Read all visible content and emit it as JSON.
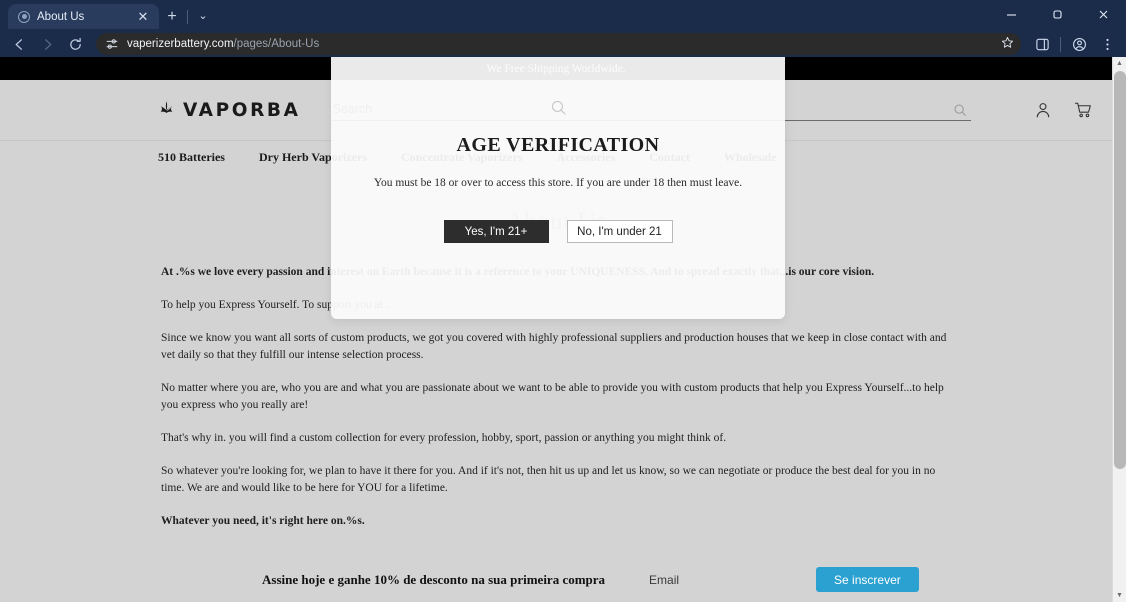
{
  "browser": {
    "tab": {
      "title": "About Us",
      "favicon": "globe-icon",
      "close": "✕"
    },
    "newtab_label": "+",
    "tablist_label": "⌄",
    "window": {
      "minimize": "—",
      "maximize": "⬜",
      "close": "✕"
    },
    "nav": {
      "back": "←",
      "forward": "→",
      "reload": "⟳"
    },
    "omnibox": {
      "domain": "vaperizerbattery.com",
      "path": "/pages/About-Us",
      "site_settings_icon": "tune-icon",
      "bookmark_icon": "star-icon"
    },
    "toolbar_icons": {
      "side_panel": "side-panel-icon",
      "profile": "profile-icon",
      "menu": "kebab-menu-icon"
    }
  },
  "site": {
    "announcement": "We Free Shipping Worldwide.",
    "logo": {
      "text": "VAPORBA",
      "icon": "cannabis-leaf-icon"
    },
    "search": {
      "placeholder": "Search",
      "value": "",
      "icon": "search-icon"
    },
    "header_icons": {
      "account": "account-icon",
      "cart": "cart-icon"
    },
    "nav": [
      {
        "label": "510 Batteries"
      },
      {
        "label": "Dry Herb Vaporizers"
      },
      {
        "label": "Concentrate Vaporizers"
      },
      {
        "label": "Accessories"
      },
      {
        "label": "Contact"
      },
      {
        "label": "Wholesale"
      }
    ],
    "page_title": "About Us",
    "paragraphs": [
      {
        "id": "p1",
        "lead": "At .%s we love every passion and interest on Earth because it is a reference to your UNIQUENESS. And to spread exactly that...is our core vision.",
        "bold": true
      },
      {
        "id": "p2",
        "lead": "To help you Express Yourself. To support you at ..",
        "bold": false
      },
      {
        "id": "p3",
        "lead": "Since we know you want all sorts of custom products, we got you covered with highly professional suppliers and production houses that we keep in close contact with and vet daily so that they fulfill our intense selection process.",
        "bold": false
      },
      {
        "id": "p4",
        "lead": "No matter where you are, who you are and what you are passionate about we want to be able to provide you with custom products that help you Express Yourself...to help you express who you really are!",
        "bold": false
      },
      {
        "id": "p5",
        "lead": "That's why in. you will find a custom collection for every profession, hobby, sport, passion or anything you might think of.",
        "bold": false
      },
      {
        "id": "p6",
        "lead": "So whatever you're looking for, we plan to have it there for you. And if it's not, then hit us up and let us know, so we can negotiate or produce the best deal for you in no time. We are and would like to be here for YOU for a lifetime.",
        "bold": false
      },
      {
        "id": "p7",
        "lead": "Whatever you need, it's right here on.%s.",
        "bold": true
      }
    ],
    "newsletter": {
      "heading": "Assine hoje e ganhe 10% de desconto na sua primeira compra",
      "email_placeholder": "Email",
      "email_value": "",
      "submit_label": "Se inscrever",
      "accent_color": "#2ba1d1"
    }
  },
  "modal": {
    "icon": "search-icon",
    "title": "AGE VERIFICATION",
    "subtitle": "You must be 18 or over to access this store. If you are under 18 then must leave.",
    "confirm_label": "Yes, I'm 21+",
    "decline_label": "No, I'm under 21",
    "confirm_color": "#2d2d2d"
  },
  "scrollbar": {
    "up": "▲",
    "down": "▼"
  }
}
